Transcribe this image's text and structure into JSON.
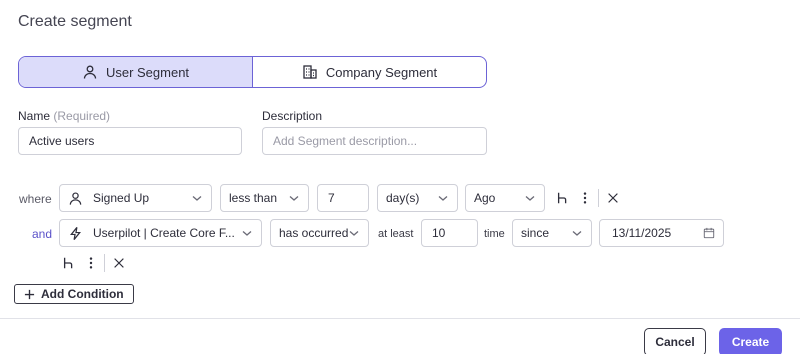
{
  "dialog": {
    "title": "Create segment"
  },
  "segment_type": {
    "user_label": "User Segment",
    "company_label": "Company Segment",
    "selected": "user"
  },
  "name_field": {
    "label": "Name",
    "required_hint": "(Required)",
    "value": "Active users"
  },
  "description_field": {
    "label": "Description",
    "placeholder": "Add Segment description..."
  },
  "conditions": [
    {
      "connector": "where",
      "attribute": "Signed Up",
      "operator": "less than",
      "value": "7",
      "unit": "day(s)",
      "direction": "Ago"
    },
    {
      "connector": "and",
      "event": "Userpilot | Create Core F...",
      "operator": "has occurred",
      "at_least_label": "at least",
      "count": "10",
      "time_label": "time",
      "time_operator": "since",
      "date": "13/11/2025"
    }
  ],
  "add_condition_label": "Add Condition",
  "footer": {
    "cancel_label": "Cancel",
    "create_label": "Create"
  },
  "colors": {
    "accent": "#6c63e8",
    "selected_bg": "#dcdcfa",
    "border": "#cfd0d8"
  }
}
